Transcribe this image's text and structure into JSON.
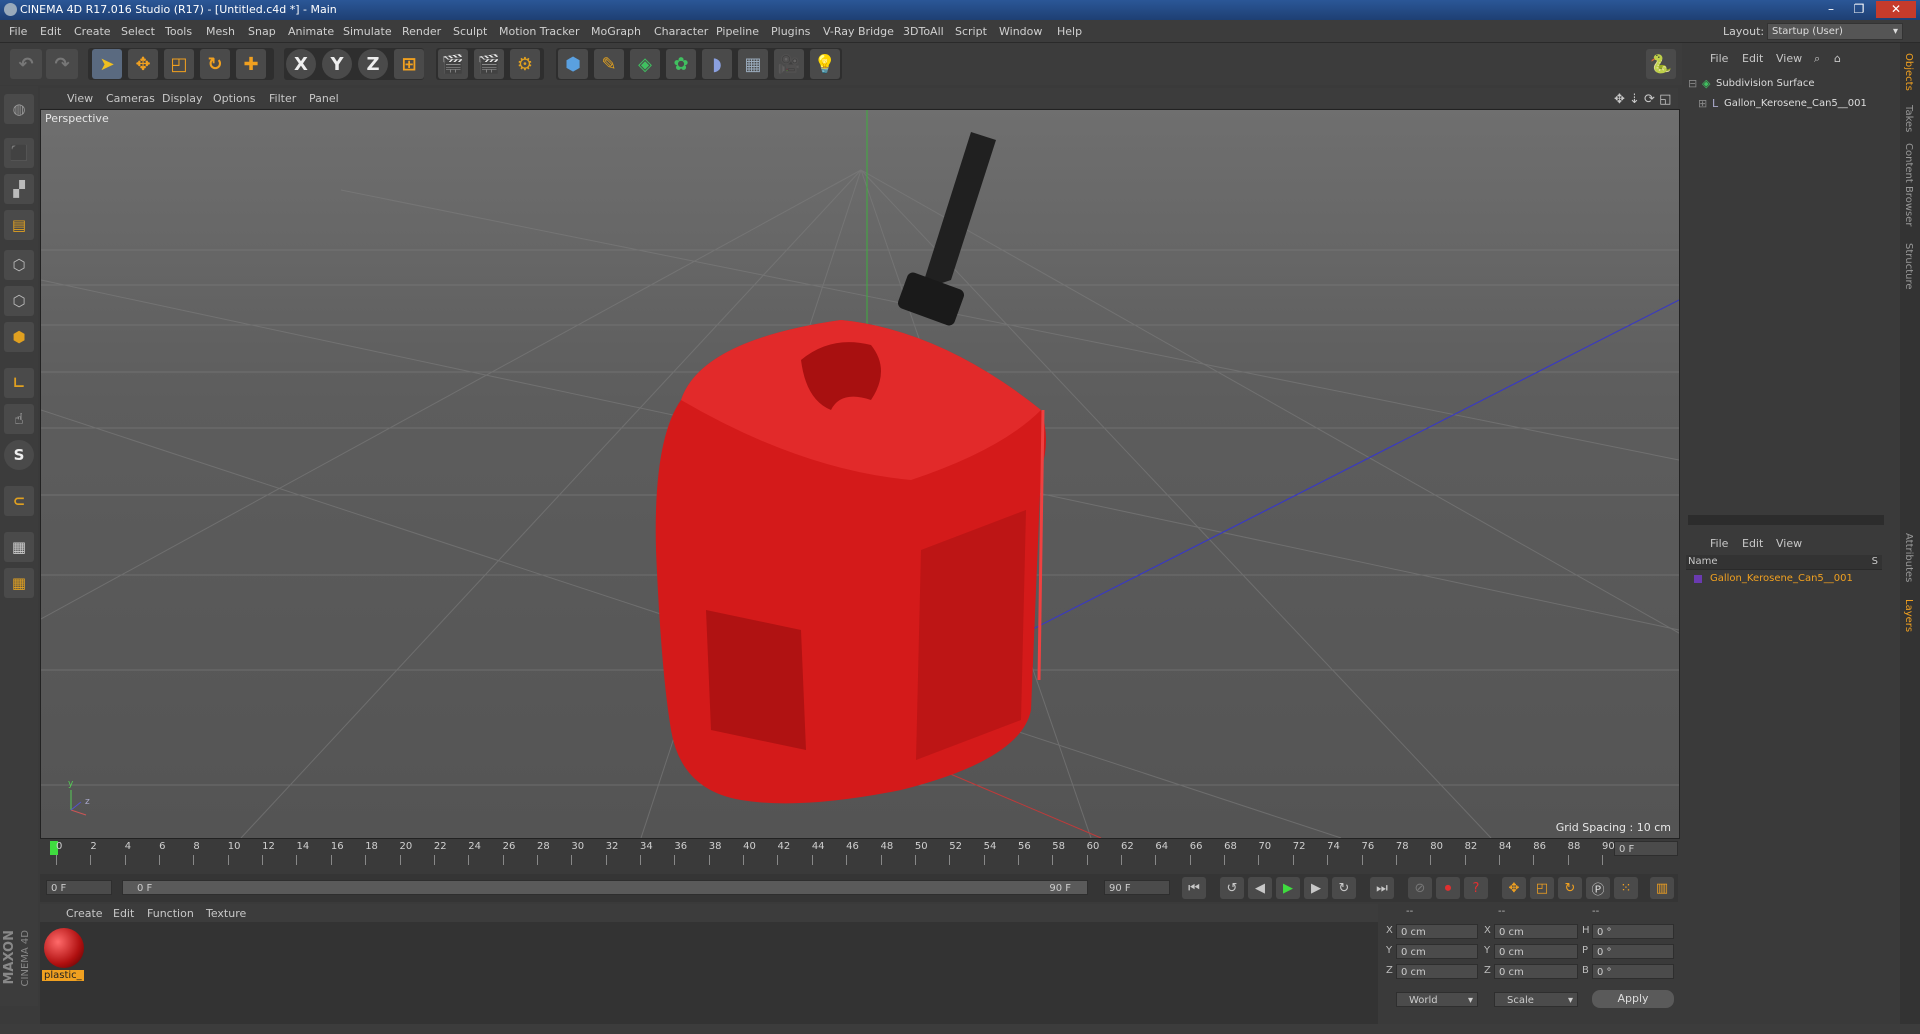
{
  "window": {
    "title": "CINEMA 4D R17.016 Studio (R17) - [Untitled.c4d *] - Main",
    "minimize": "–",
    "restore": "❐",
    "close": "✕"
  },
  "menu": [
    "File",
    "Edit",
    "Create",
    "Select",
    "Tools",
    "Mesh",
    "Snap",
    "Animate",
    "Simulate",
    "Render",
    "Sculpt",
    "Motion Tracker",
    "MoGraph",
    "Character",
    "Pipeline",
    "Plugins",
    "V-Ray Bridge",
    "3DToAll",
    "Script",
    "Window",
    "Help"
  ],
  "layout": {
    "label": "Layout:",
    "value": "Startup (User)"
  },
  "toolbar": {
    "x": "X",
    "y": "Y",
    "z": "Z"
  },
  "lefttools": {
    "sculpt_label": "S"
  },
  "viewport": {
    "menu": [
      "View",
      "Cameras",
      "Display",
      "Options",
      "Filter",
      "Panel"
    ],
    "label": "Perspective",
    "grid_spacing": "Grid Spacing : 10 cm",
    "axis_y": "y",
    "axis_z": "z"
  },
  "timeline": {
    "ticks": [
      "0",
      "2",
      "4",
      "6",
      "8",
      "10",
      "12",
      "14",
      "16",
      "18",
      "20",
      "22",
      "24",
      "26",
      "28",
      "30",
      "32",
      "34",
      "36",
      "38",
      "40",
      "42",
      "44",
      "46",
      "48",
      "50",
      "52",
      "54",
      "56",
      "58",
      "60",
      "62",
      "64",
      "66",
      "68",
      "70",
      "72",
      "74",
      "76",
      "78",
      "80",
      "82",
      "84",
      "86",
      "88",
      "90"
    ],
    "current_frame": "0 F",
    "start_field": "0 F",
    "range_start": "0 F",
    "range_end": "90 F",
    "end_field": "90 F"
  },
  "material_manager": {
    "menu": [
      "Create",
      "Edit",
      "Function",
      "Texture"
    ],
    "material_name": "plastic_"
  },
  "coordinates": {
    "header": [
      "--",
      "--",
      "--"
    ],
    "rows": [
      {
        "l1": "X",
        "v1": "0 cm",
        "l2": "X",
        "v2": "0 cm",
        "l3": "H",
        "v3": "0 °"
      },
      {
        "l1": "Y",
        "v1": "0 cm",
        "l2": "Y",
        "v2": "0 cm",
        "l3": "P",
        "v3": "0 °"
      },
      {
        "l1": "Z",
        "v1": "0 cm",
        "l2": "Z",
        "v2": "0 cm",
        "l3": "B",
        "v3": "0 °"
      }
    ],
    "world": "World",
    "scale": "Scale",
    "apply": "Apply"
  },
  "object_manager": {
    "menu": [
      "File",
      "Edit",
      "View"
    ],
    "items": [
      "Subdivision Surface",
      "Gallon_Kerosene_Can5__001"
    ]
  },
  "layer_manager": {
    "menu": [
      "File",
      "Edit",
      "View"
    ],
    "col_name": "Name",
    "col_s": "S",
    "item": "Gallon_Kerosene_Can5__001"
  },
  "right_tabs": [
    "Objects",
    "Takes",
    "Content Browser",
    "Structure",
    "Attributes",
    "Layers"
  ],
  "brand": {
    "maxon": "MAXON",
    "product": "CINEMA 4D"
  },
  "colors": {
    "accent_blue": "#2b5797",
    "layer_item": "#f0a020",
    "can_red": "#d41a1a"
  }
}
